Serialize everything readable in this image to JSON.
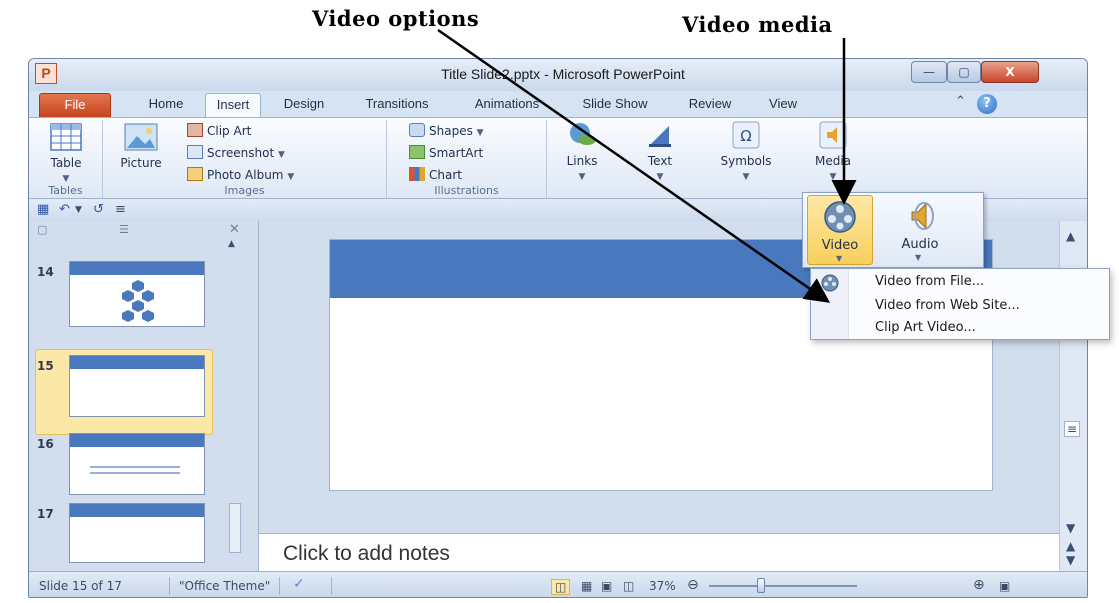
{
  "annotations": {
    "left": "Video options",
    "right": "Video media"
  },
  "window": {
    "title": "Title Slide2.pptx  -  Microsoft PowerPoint",
    "app_icon": "P",
    "controls": {
      "minimize": "—",
      "maximize": "▢",
      "close": "X"
    }
  },
  "tabs": {
    "file": "File",
    "items": [
      "Home",
      "Insert",
      "Design",
      "Transitions",
      "Animations",
      "Slide Show",
      "Review",
      "View"
    ],
    "active": "Insert",
    "help_icon": "?"
  },
  "ribbon": {
    "tables": {
      "button": "Table",
      "group": "Tables"
    },
    "images": {
      "picture": "Picture",
      "clip_art": "Clip Art",
      "screenshot": "Screenshot",
      "photo_album": "Photo Album",
      "group": "Images"
    },
    "illustrations": {
      "shapes": "Shapes",
      "smartart": "SmartArt",
      "chart": "Chart",
      "group": "Illustrations"
    },
    "links": "Links",
    "text": "Text",
    "symbols": "Symbols",
    "media": "Media"
  },
  "thumbnails": [
    {
      "number": "14",
      "selected": false
    },
    {
      "number": "15",
      "selected": true
    },
    {
      "number": "16",
      "selected": false
    },
    {
      "number": "17",
      "selected": false
    }
  ],
  "media_popup": {
    "video": "Video",
    "audio": "Audio"
  },
  "video_menu": {
    "from_file": "Video from File...",
    "from_web": "Video from Web Site...",
    "clip_art": "Clip Art Video..."
  },
  "notes": {
    "placeholder": "Click to add notes"
  },
  "status": {
    "slide": "Slide 15 of 17",
    "theme": "\"Office Theme\"",
    "zoom": "37%"
  },
  "colors": {
    "file_tab": "#c3451d",
    "slide_band": "#4a78bf",
    "selected_thumb": "#fbe7a6",
    "video_highlight": "#f8cf5c"
  }
}
